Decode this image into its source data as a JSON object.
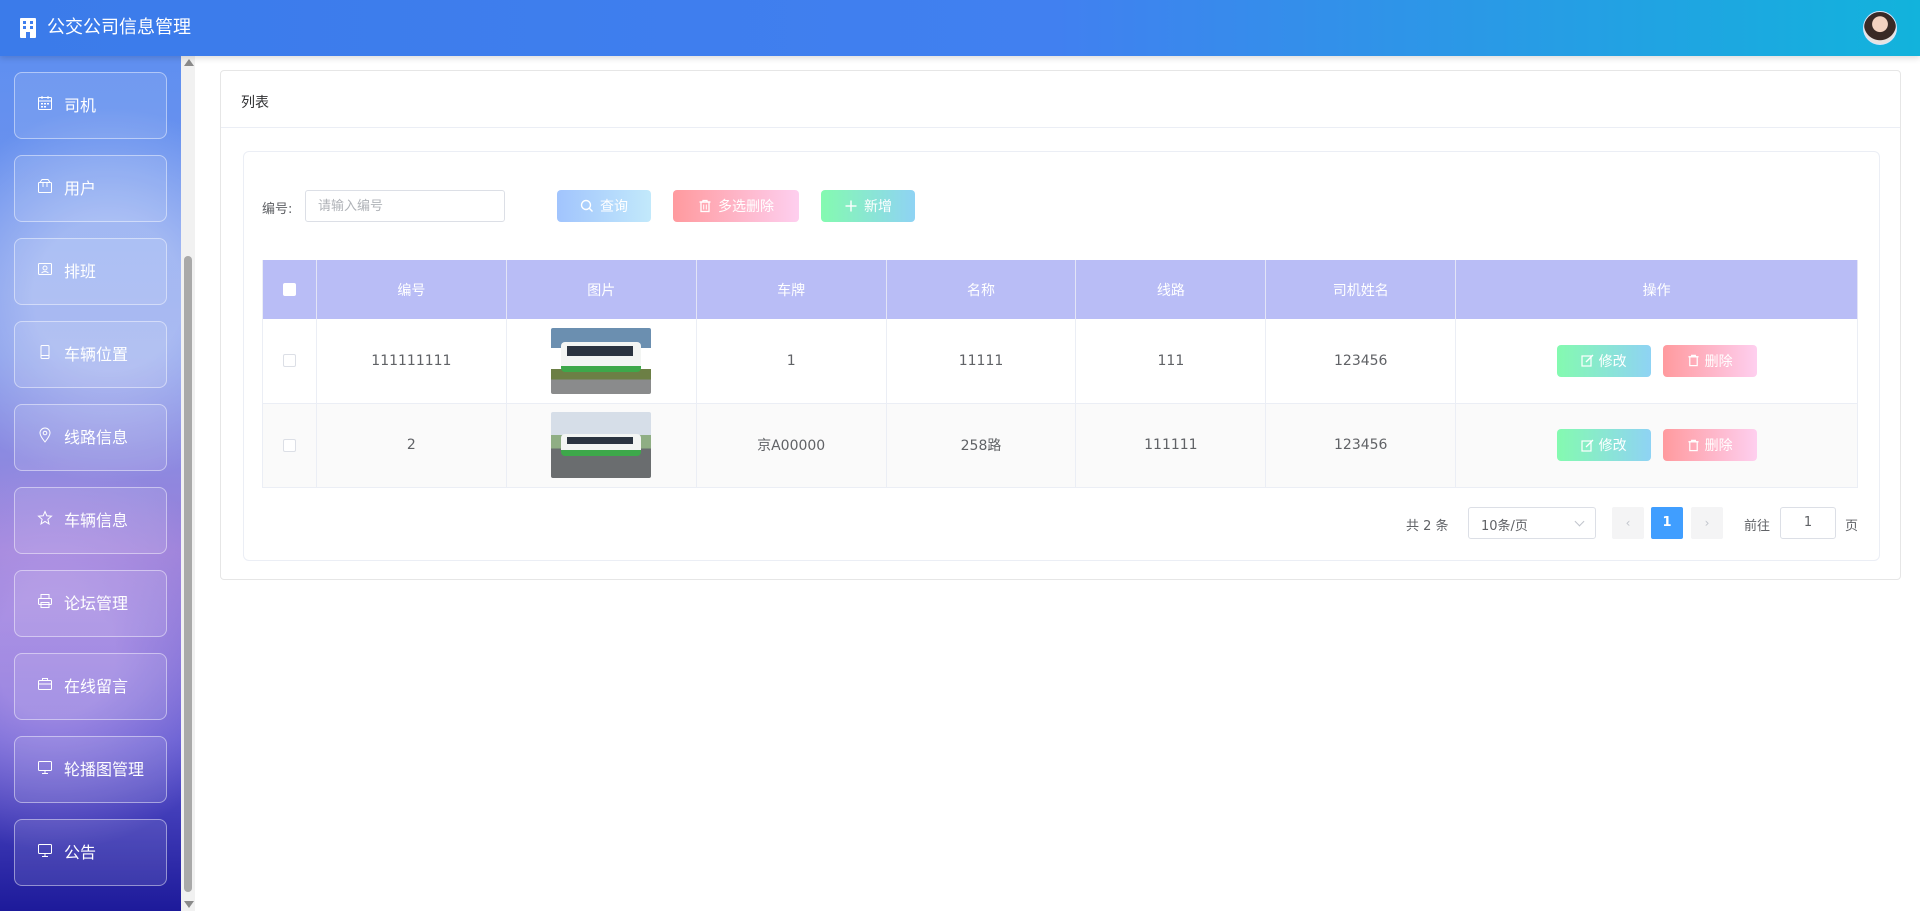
{
  "header": {
    "title": "公交公司信息管理"
  },
  "sidebar": {
    "items": [
      {
        "label": "司机",
        "icon": "calendar-icon"
      },
      {
        "label": "用户",
        "icon": "box-icon"
      },
      {
        "label": "排班",
        "icon": "id-card-icon"
      },
      {
        "label": "车辆位置",
        "icon": "mobile-icon"
      },
      {
        "label": "线路信息",
        "icon": "pin-icon"
      },
      {
        "label": "车辆信息",
        "icon": "star-icon"
      },
      {
        "label": "论坛管理",
        "icon": "printer-icon"
      },
      {
        "label": "在线留言",
        "icon": "briefcase-icon"
      },
      {
        "label": "轮播图管理",
        "icon": "monitor-icon"
      },
      {
        "label": "公告",
        "icon": "monitor-icon"
      }
    ]
  },
  "main": {
    "title": "列表",
    "search": {
      "label": "编号:",
      "placeholder": "请输入编号",
      "value": ""
    },
    "buttons": {
      "query": "查询",
      "multi_delete": "多选删除",
      "add": "新增"
    },
    "table": {
      "columns": [
        "编号",
        "图片",
        "车牌",
        "名称",
        "线路",
        "司机姓名",
        "操作"
      ],
      "rows": [
        {
          "id": "111111111",
          "plate": "1",
          "name": "11111",
          "route": "111",
          "driver": "123456"
        },
        {
          "id": "2",
          "plate": "京A00000",
          "name": "258路",
          "route": "111111",
          "driver": "123456"
        }
      ],
      "actions": {
        "edit": "修改",
        "delete": "删除"
      }
    },
    "pagination": {
      "total": "共 2 条",
      "page_size": "10条/页",
      "prev": "‹",
      "next": "›",
      "current": "1",
      "goto_label": "前往",
      "goto_value": "1",
      "page_suffix": "页"
    }
  },
  "colors": {
    "header_start": "#3b7bea",
    "header_end": "#12b3dc",
    "table_header": "#b9bdf6",
    "page_active": "#409eff"
  }
}
